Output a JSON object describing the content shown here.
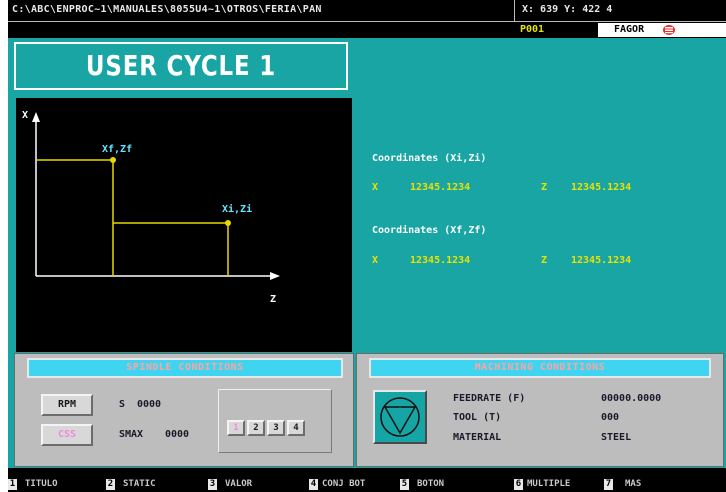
{
  "header": {
    "path": "C:\\ABC\\ENPROC~1\\MANUALES\\8055U4~1\\OTROS\\FERIA\\PAN",
    "coords": "X: 639  Y: 422    4",
    "program": "P001",
    "brand": "FAGOR"
  },
  "cycle": {
    "title": "USER CYCLE 1"
  },
  "graph": {
    "x_axis": "X",
    "z_axis": "Z",
    "point_final": "Xf,Zf",
    "point_initial": "Xi,Zi"
  },
  "coordinates": {
    "initial_title": "Coordinates (Xi,Zi)",
    "initial_x_label": "X",
    "initial_x": "12345.1234",
    "initial_z_label": "Z",
    "initial_z": "12345.1234",
    "final_title": "Coordinates (Xf,Zf)",
    "final_x_label": "X",
    "final_x": "12345.1234",
    "final_z_label": "Z",
    "final_z": "12345.1234"
  },
  "spindle": {
    "title": "SPINDLE CONDITIONS",
    "rpm_label": "RPM",
    "css_label": "CSS",
    "s_label": "S",
    "s_value": "0000",
    "smax_label": "SMAX",
    "smax_value": "0000",
    "gears": [
      "1",
      "2",
      "3",
      "4"
    ]
  },
  "machining": {
    "title": "MACHINING CONDITIONS",
    "feedrate_label": "FEEDRATE (F)",
    "feedrate_value": "00000.0000",
    "tool_label": "TOOL (T)",
    "tool_value": "000",
    "material_label": "MATERIAL",
    "material_value": "STEEL"
  },
  "softkeys": [
    {
      "num": "1",
      "label": "TITULO"
    },
    {
      "num": "2",
      "label": "STATIC"
    },
    {
      "num": "3",
      "label": "VALOR"
    },
    {
      "num": "4",
      "label": "CONJ BOT"
    },
    {
      "num": "5",
      "label": "BOTON"
    },
    {
      "num": "6",
      "label": "MULTIPLE"
    },
    {
      "num": "7",
      "label": "MAS"
    }
  ],
  "colors": {
    "background_teal": "#1aa5a5",
    "panel_grey": "#bdbdbd",
    "panel_header_cyan": "#3fd4ef",
    "panel_header_text": "#ffa3a3",
    "data_yellow": "#e8e300",
    "graph_label_cyan": "#5fe8ff",
    "line_yellow": "#e8d800",
    "icon_button_teal": "#16a5a5"
  }
}
